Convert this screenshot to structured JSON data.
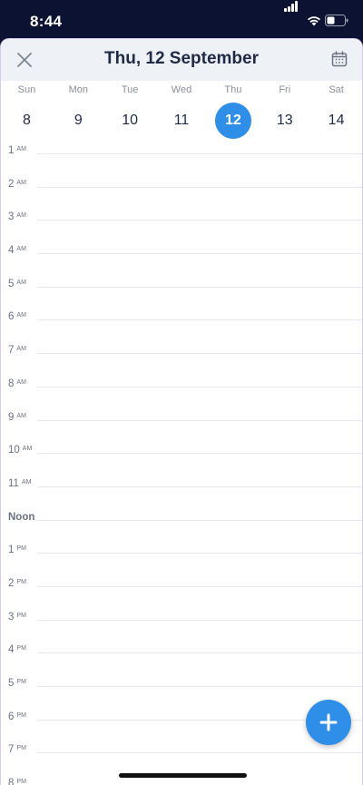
{
  "status": {
    "time": "8:44"
  },
  "header": {
    "title": "Thu, 12 September"
  },
  "week": [
    {
      "name": "Sun",
      "num": "8"
    },
    {
      "name": "Mon",
      "num": "9"
    },
    {
      "name": "Tue",
      "num": "10"
    },
    {
      "name": "Wed",
      "num": "11"
    },
    {
      "name": "Thu",
      "num": "12",
      "selected": true
    },
    {
      "name": "Fri",
      "num": "13"
    },
    {
      "name": "Sat",
      "num": "14"
    }
  ],
  "hours": [
    {
      "num": "1",
      "suffix": "AM"
    },
    {
      "num": "2",
      "suffix": "AM"
    },
    {
      "num": "3",
      "suffix": "AM"
    },
    {
      "num": "4",
      "suffix": "AM"
    },
    {
      "num": "5",
      "suffix": "AM"
    },
    {
      "num": "6",
      "suffix": "AM"
    },
    {
      "num": "7",
      "suffix": "AM"
    },
    {
      "num": "8",
      "suffix": "AM"
    },
    {
      "num": "9",
      "suffix": "AM"
    },
    {
      "num": "10",
      "suffix": "AM"
    },
    {
      "num": "11",
      "suffix": "AM"
    },
    {
      "num": "Noon",
      "suffix": ""
    },
    {
      "num": "1",
      "suffix": "PM"
    },
    {
      "num": "2",
      "suffix": "PM"
    },
    {
      "num": "3",
      "suffix": "PM"
    },
    {
      "num": "4",
      "suffix": "PM"
    },
    {
      "num": "5",
      "suffix": "PM"
    },
    {
      "num": "6",
      "suffix": "PM"
    },
    {
      "num": "7",
      "suffix": "PM"
    },
    {
      "num": "8",
      "suffix": "PM"
    }
  ],
  "colors": {
    "accent": "#2f8ee8",
    "title": "#1e2a46",
    "statusbar": "#0b1232"
  },
  "icons": {
    "close": "close-icon",
    "calendar": "calendar-icon",
    "add": "plus-icon"
  }
}
